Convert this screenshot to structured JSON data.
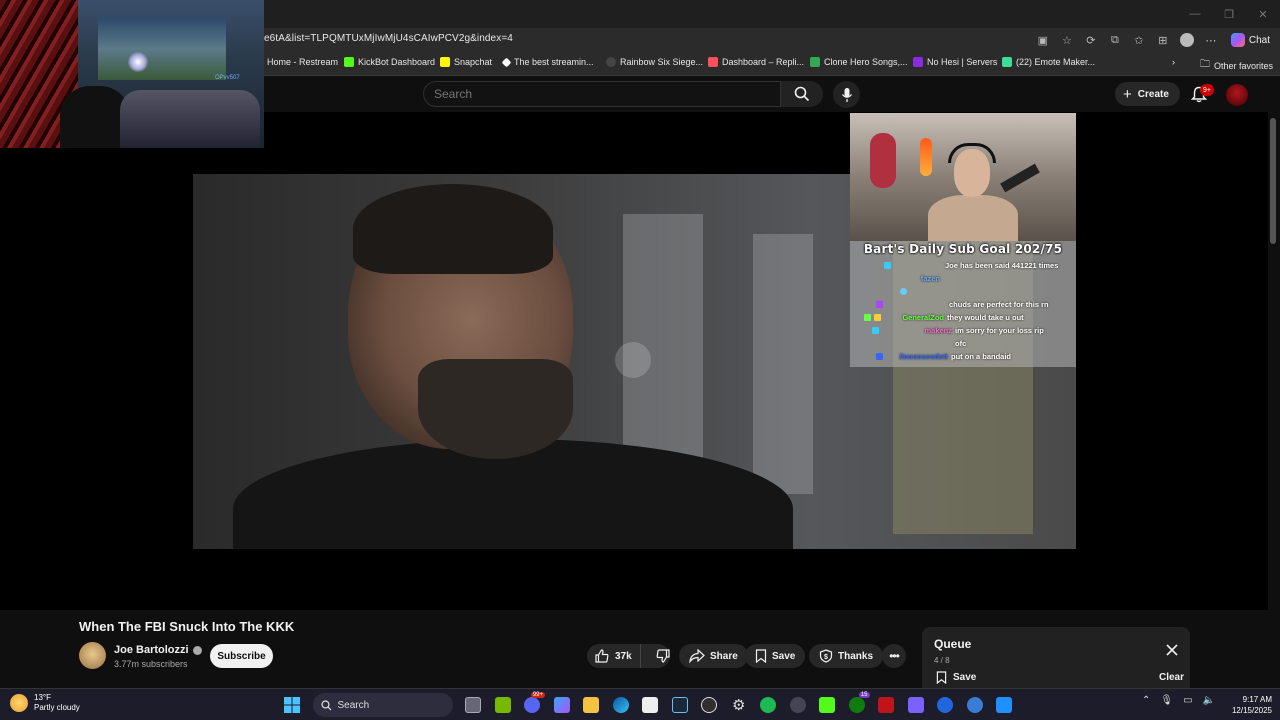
{
  "browser": {
    "url": "e6tA&list=TLPQMTUxMjIwMjU4sCAIwPCV2g&index=4",
    "chat_label": "Chat",
    "bookmarks": [
      {
        "label": "Home - Restream",
        "color": "#555555"
      },
      {
        "label": "KickBot Dashboard",
        "color": "#53fc18"
      },
      {
        "label": "Snapchat",
        "color": "#fffc00"
      },
      {
        "label": "The best streamin...",
        "color": "#ffffff"
      },
      {
        "label": "Rainbow Six Siege...",
        "color": "#aaaaaa"
      },
      {
        "label": "Dashboard – Repli...",
        "color": "#ff4f5e"
      },
      {
        "label": "Clone Hero Songs,...",
        "color": "#34a853"
      },
      {
        "label": "No Hesi | Servers",
        "color": "#8a2be2"
      },
      {
        "label": "(22) Emote Maker...",
        "color": "#3ddc97"
      }
    ],
    "other_favorites": "Other favorites"
  },
  "youtube": {
    "search_placeholder": "Search",
    "create_label": "Create",
    "notification_count": "9+"
  },
  "webcam": {
    "tag": "OPvv507"
  },
  "stream_overlay": {
    "sub_goal": "Bart's Daily Sub Goal 202/75",
    "chat": [
      {
        "user": "",
        "message": "Joe has been said 441221 times",
        "color": "#33ccff"
      },
      {
        "user": "fazen",
        "message": "",
        "color": "#66aaff"
      },
      {
        "user": "",
        "message": "",
        "color": "#66ccff"
      },
      {
        "user": "",
        "message": "chuds are perfect for this rn",
        "color": "#aa44ff"
      },
      {
        "user": "GeneralZod",
        "message": "they would take u out",
        "color": "#66ff44"
      },
      {
        "user": "makenz",
        "message": "im sorry for your loss rip",
        "color": "#ff66cc"
      },
      {
        "user": "",
        "message": "ofc",
        "color": "#33cc66"
      },
      {
        "user": "ilooooseedstt",
        "message": "put on a bandaid",
        "color": "#3366ff"
      }
    ]
  },
  "video": {
    "title": "When The FBI Snuck Into The KKK",
    "channel": "Joe Bartolozzi",
    "subscribers": "3.77m subscribers",
    "subscribe_label": "Subscribe",
    "likes": "37k",
    "share_label": "Share",
    "save_label": "Save",
    "thanks_label": "Thanks"
  },
  "queue": {
    "title": "Queue",
    "position": "4 / 8",
    "save_label": "Save",
    "clear_label": "Clear"
  },
  "taskbar": {
    "temperature": "13°F",
    "weather": "Partly cloudy",
    "search_label": "Search",
    "discord_badge": "99+",
    "xbox_badge": "15",
    "time": "9:17 AM",
    "date": "12/15/2025"
  }
}
